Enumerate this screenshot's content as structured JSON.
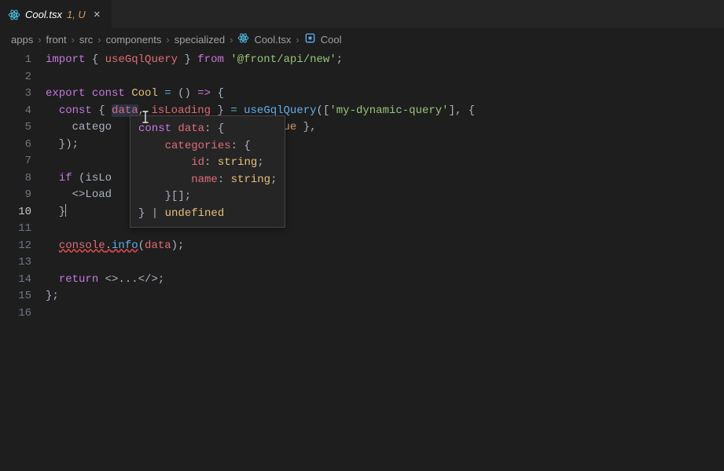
{
  "tab": {
    "filename": "Cool.tsx",
    "modifiedSuffix": "1, U"
  },
  "breadcrumbs": {
    "items": [
      "apps",
      "front",
      "src",
      "components",
      "specialized",
      "Cool.tsx",
      "Cool"
    ],
    "symbolIndex": 5
  },
  "code": {
    "lines": [
      {
        "n": 1,
        "segs": [
          {
            "t": "import",
            "c": "c-kw"
          },
          {
            "t": " { ",
            "c": "c-pun"
          },
          {
            "t": "useGqlQuery",
            "c": "c-var"
          },
          {
            "t": " } ",
            "c": "c-pun"
          },
          {
            "t": "from",
            "c": "c-kw"
          },
          {
            "t": " ",
            "c": ""
          },
          {
            "t": "'@front/api/new'",
            "c": "c-str"
          },
          {
            "t": ";",
            "c": "c-pun"
          }
        ]
      },
      {
        "n": 2,
        "segs": []
      },
      {
        "n": 3,
        "segs": [
          {
            "t": "export",
            "c": "c-kw"
          },
          {
            "t": " ",
            "c": ""
          },
          {
            "t": "const",
            "c": "c-kw"
          },
          {
            "t": " ",
            "c": ""
          },
          {
            "t": "Cool",
            "c": "c-const"
          },
          {
            "t": " ",
            "c": ""
          },
          {
            "t": "=",
            "c": "c-op"
          },
          {
            "t": " () ",
            "c": "c-pun"
          },
          {
            "t": "=>",
            "c": "c-kw"
          },
          {
            "t": " {",
            "c": "c-pun"
          }
        ]
      },
      {
        "n": 4,
        "segs": [
          {
            "t": "  ",
            "c": ""
          },
          {
            "t": "const",
            "c": "c-kw"
          },
          {
            "t": " { ",
            "c": "c-pun"
          },
          {
            "t": "data",
            "c": "c-var c-sel"
          },
          {
            "t": ", ",
            "c": "c-pun"
          },
          {
            "t": "isLoading",
            "c": "c-var"
          },
          {
            "t": " } ",
            "c": "c-pun"
          },
          {
            "t": "=",
            "c": "c-op"
          },
          {
            "t": " ",
            "c": ""
          },
          {
            "t": "useGqlQuery",
            "c": "c-fn"
          },
          {
            "t": "([",
            "c": "c-pun"
          },
          {
            "t": "'my-dynamic-query'",
            "c": "c-str"
          },
          {
            "t": "], {",
            "c": "c-pun"
          }
        ]
      },
      {
        "n": 5,
        "segs": [
          {
            "t": "    ",
            "c": ""
          },
          {
            "t": "catego",
            "c": "c-txt"
          },
          {
            "t": "                        ",
            "c": ""
          },
          {
            "t": "true",
            "c": "c-bool"
          },
          {
            "t": " },",
            "c": "c-pun"
          }
        ]
      },
      {
        "n": 6,
        "segs": [
          {
            "t": "  });",
            "c": "c-pun"
          }
        ]
      },
      {
        "n": 7,
        "segs": []
      },
      {
        "n": 8,
        "segs": [
          {
            "t": "  ",
            "c": ""
          },
          {
            "t": "if",
            "c": "c-kw"
          },
          {
            "t": " (",
            "c": "c-pun"
          },
          {
            "t": "isLo",
            "c": "c-txt"
          }
        ]
      },
      {
        "n": 9,
        "segs": [
          {
            "t": "    <>",
            "c": "c-pun"
          },
          {
            "t": "Load",
            "c": "c-txt"
          }
        ]
      },
      {
        "n": 10,
        "active": true,
        "segs": [
          {
            "t": "  }",
            "c": "c-pun"
          },
          {
            "cursor": true
          }
        ]
      },
      {
        "n": 11,
        "segs": []
      },
      {
        "n": 12,
        "segs": [
          {
            "t": "  ",
            "c": ""
          },
          {
            "t": "console",
            "c": "c-var err-underline"
          },
          {
            "t": ".",
            "c": "c-pun err-underline"
          },
          {
            "t": "info",
            "c": "c-fn err-underline"
          },
          {
            "t": "(",
            "c": "c-pun"
          },
          {
            "t": "data",
            "c": "c-var"
          },
          {
            "t": ");",
            "c": "c-pun"
          }
        ]
      },
      {
        "n": 13,
        "segs": []
      },
      {
        "n": 14,
        "segs": [
          {
            "t": "  ",
            "c": ""
          },
          {
            "t": "return",
            "c": "c-kw"
          },
          {
            "t": " <>...</>;",
            "c": "c-pun"
          }
        ]
      },
      {
        "n": 15,
        "segs": [
          {
            "t": "};",
            "c": "c-pun"
          }
        ]
      },
      {
        "n": 16,
        "segs": []
      }
    ]
  },
  "hover": {
    "lines": [
      [
        {
          "t": "const",
          "c": "c-kw"
        },
        {
          "t": " ",
          "c": ""
        },
        {
          "t": "data",
          "c": "c-var"
        },
        {
          "t": ": {",
          "c": "c-pun"
        }
      ],
      [
        {
          "t": "    ",
          "c": ""
        },
        {
          "t": "categories",
          "c": "c-var"
        },
        {
          "t": ": {",
          "c": "c-pun"
        }
      ],
      [
        {
          "t": "        ",
          "c": ""
        },
        {
          "t": "id",
          "c": "c-var"
        },
        {
          "t": ": ",
          "c": "c-pun"
        },
        {
          "t": "string",
          "c": "c-type"
        },
        {
          "t": ";",
          "c": "c-pun"
        }
      ],
      [
        {
          "t": "        ",
          "c": ""
        },
        {
          "t": "name",
          "c": "c-var"
        },
        {
          "t": ": ",
          "c": "c-pun"
        },
        {
          "t": "string",
          "c": "c-type"
        },
        {
          "t": ";",
          "c": "c-pun"
        }
      ],
      [
        {
          "t": "    }[];",
          "c": "c-pun"
        }
      ],
      [
        {
          "t": "} | ",
          "c": "c-pun"
        },
        {
          "t": "undefined",
          "c": "c-type"
        }
      ]
    ]
  }
}
